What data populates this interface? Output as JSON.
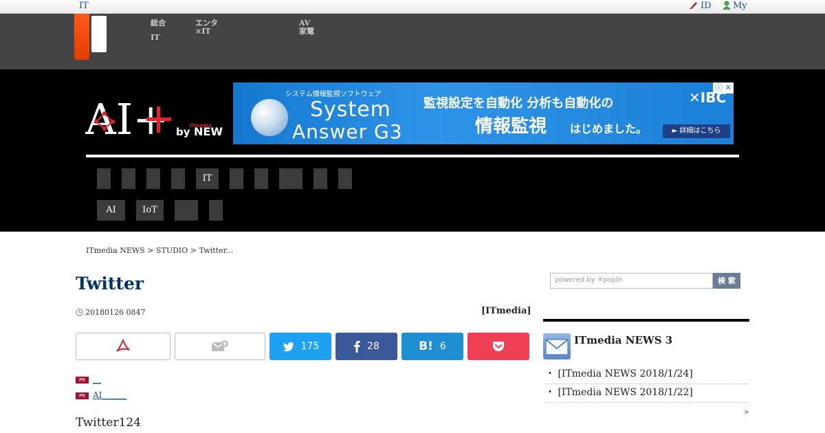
{
  "topbar": {
    "site_label": "IT",
    "id_label": "ID",
    "my_label": "My"
  },
  "nav": {
    "items": [
      {
        "line1": "総合",
        "line2": "IT"
      },
      {
        "line1": "エンタ",
        "line2": "×IT"
      },
      {
        "line1": "AV",
        "line2": "家電"
      }
    ]
  },
  "logo": {
    "main": "AI+",
    "by": "by",
    "brand_small": "ITmedia",
    "brand": "NEWS"
  },
  "banner": {
    "tagline": "システム情報監視ソフトウェア",
    "product1": "System",
    "product2": "Answer G3",
    "headline1": "監視設定を自動化  分析も自動化の",
    "headline2": "情報監視",
    "headline3": "はじめました。",
    "brand": "IBC",
    "cta": "► 詳細はこちら",
    "ad_close": "ⓘ ✕"
  },
  "categories": {
    "row1": [
      "",
      "",
      "",
      "",
      "IT",
      "",
      "",
      "",
      "",
      ""
    ],
    "row2": [
      "AI",
      "IoT",
      "",
      ""
    ]
  },
  "breadcrumb": "ITmedia NEWS > STUDIO > Twitter...",
  "article": {
    "title": "Twitter",
    "date": "20180126 0847",
    "byline": "[ITmedia]",
    "body_start": "Twitter124"
  },
  "share": {
    "twitter_count": "175",
    "facebook_count": "28",
    "hatena_count": "6"
  },
  "pr_links": [
    {
      "badge": "PR",
      "text": "__"
    },
    {
      "badge": "PR",
      "text": "AI______"
    }
  ],
  "sidebar": {
    "search_placeholder": "powered by ✕popIn",
    "search_button": "検 索",
    "ranking_title": "ITmedia NEWS 3",
    "items": [
      "・ [ITmedia NEWS   2018/1/24]",
      "・  [ITmedia NEWS   2018/1/22]"
    ],
    "more": "»"
  },
  "colors": {
    "accent": "#e23d00",
    "title": "#003366",
    "twitter": "#1da1f2",
    "facebook": "#3b5998",
    "hatena": "#1d8fd0",
    "pocket": "#ef4056"
  }
}
